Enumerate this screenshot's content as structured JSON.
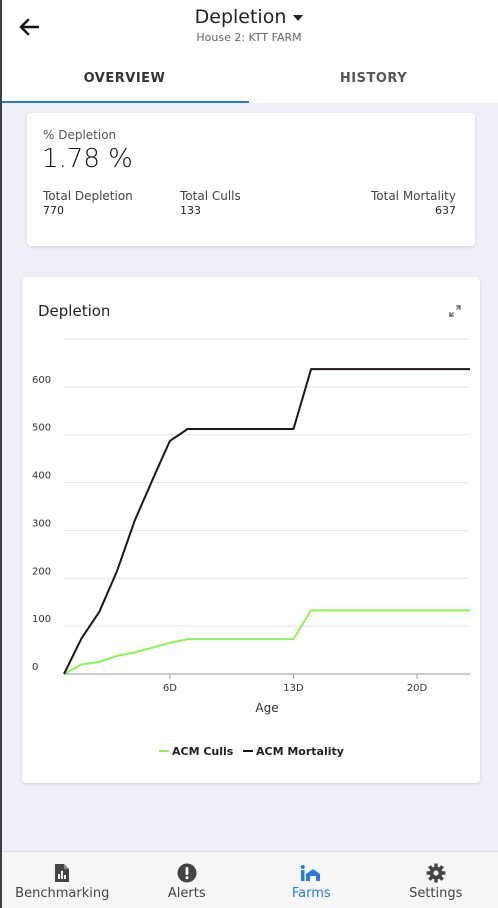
{
  "header": {
    "title": "Depletion",
    "subtitle": "House 2: KTT FARM",
    "back_icon": "arrow-left-icon"
  },
  "tabs": [
    {
      "label": "OVERVIEW",
      "active": true
    },
    {
      "label": "HISTORY",
      "active": false
    }
  ],
  "summary": {
    "depletion_label": "% Depletion",
    "depletion_value": "1.78 %",
    "stats": [
      {
        "label": "Total Depletion",
        "value": "770"
      },
      {
        "label": "Total Culls",
        "value": "133"
      },
      {
        "label": "Total Mortality",
        "value": "637"
      }
    ]
  },
  "chart_card": {
    "title": "Depletion",
    "expand_icon": "expand-icon"
  },
  "chart_data": {
    "type": "line",
    "title": "",
    "xlabel": "Age",
    "ylabel": "",
    "x_ticks": [
      {
        "x": 6,
        "label": "6D"
      },
      {
        "x": 13,
        "label": "13D"
      },
      {
        "x": 20,
        "label": "20D"
      }
    ],
    "y_ticks": [
      0,
      100,
      200,
      300,
      400,
      500,
      600
    ],
    "xlim": [
      0,
      23
    ],
    "ylim": [
      0,
      700
    ],
    "grid": true,
    "legend_position": "bottom",
    "series": [
      {
        "name": "ACM Culls",
        "color": "#8ef05a",
        "x": [
          0,
          1,
          2,
          3,
          4,
          5,
          6,
          7,
          8,
          9,
          10,
          11,
          12,
          13,
          14,
          15,
          16,
          17,
          18,
          19,
          20,
          21,
          22,
          23
        ],
        "y": [
          0,
          20,
          25,
          38,
          45,
          55,
          65,
          73,
          73,
          73,
          73,
          73,
          73,
          73,
          133,
          133,
          133,
          133,
          133,
          133,
          133,
          133,
          133,
          133
        ]
      },
      {
        "name": "ACM Mortality",
        "color": "#1e1616",
        "x": [
          0,
          1,
          2,
          3,
          4,
          5,
          6,
          7,
          8,
          9,
          10,
          11,
          12,
          13,
          14,
          15,
          16,
          17,
          18,
          19,
          20,
          21,
          22,
          23
        ],
        "y": [
          0,
          75,
          130,
          215,
          320,
          405,
          487,
          512,
          512,
          512,
          512,
          512,
          512,
          512,
          637,
          637,
          637,
          637,
          637,
          637,
          637,
          637,
          637,
          637
        ]
      }
    ]
  },
  "bottom_nav": [
    {
      "label": "Benchmarking",
      "icon": "bar-chart-doc-icon",
      "active": false
    },
    {
      "label": "Alerts",
      "icon": "alert-circle-icon",
      "active": false
    },
    {
      "label": "Farms",
      "icon": "farm-icon",
      "active": true
    },
    {
      "label": "Settings",
      "icon": "gear-icon",
      "active": false
    }
  ]
}
